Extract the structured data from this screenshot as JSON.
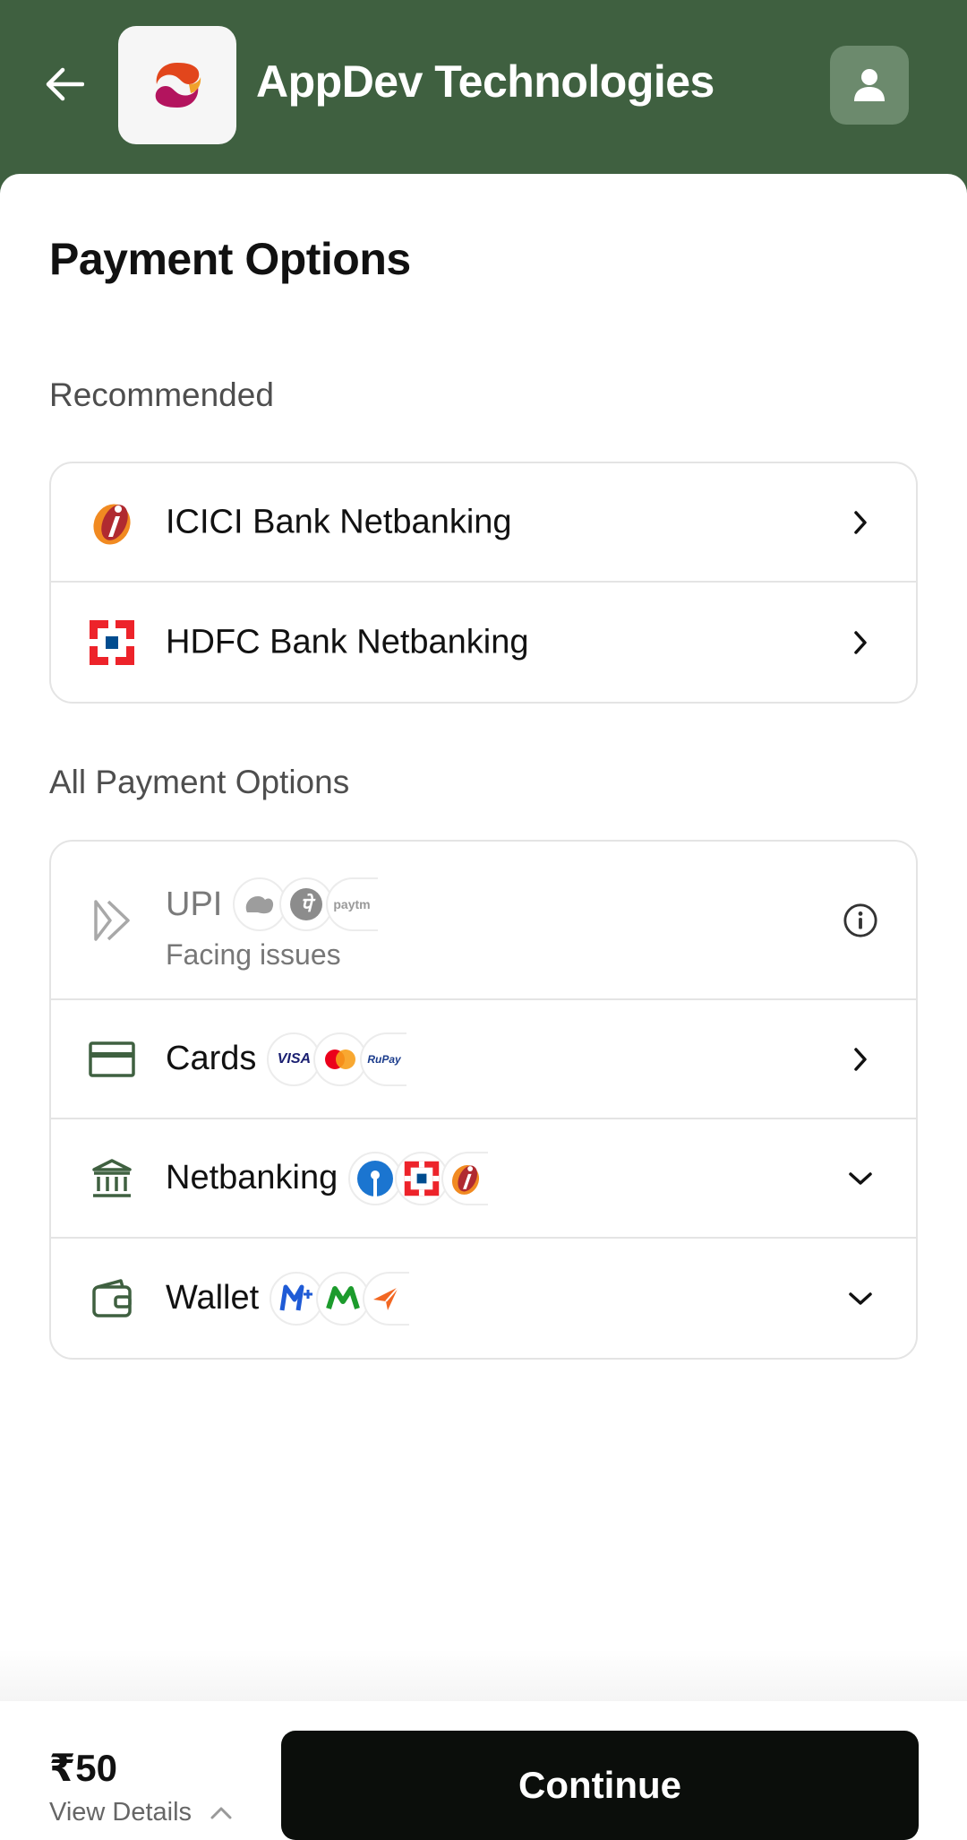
{
  "header": {
    "title": "AppDev Technologies",
    "back_icon": "arrow-left-icon",
    "profile_icon": "user-icon",
    "background": "#3f6040"
  },
  "main": {
    "title": "Payment Options",
    "recommended": {
      "label": "Recommended",
      "items": [
        {
          "label": "ICICI Bank Netbanking",
          "icon": "icici-logo"
        },
        {
          "label": "HDFC Bank Netbanking",
          "icon": "hdfc-logo"
        }
      ]
    },
    "all": {
      "label": "All Payment Options",
      "upi": {
        "label": "UPI",
        "status": "Facing issues",
        "logo_text": "paytm"
      },
      "cards": {
        "label": "Cards",
        "visa": "VISA",
        "rupay": "RuPay"
      },
      "netbanking": {
        "label": "Netbanking"
      },
      "wallet": {
        "label": "Wallet"
      }
    }
  },
  "footer": {
    "amount": "₹50",
    "view_details": "View Details",
    "continue_label": "Continue",
    "button_color": "#0b0e0b"
  }
}
